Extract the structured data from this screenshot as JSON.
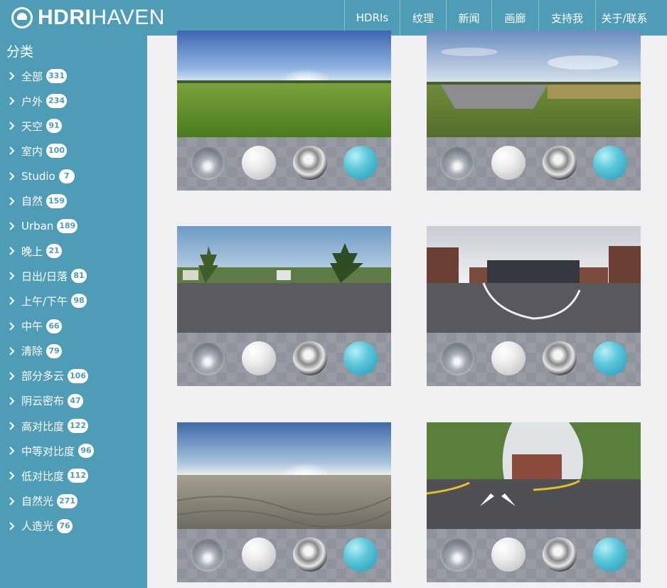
{
  "header": {
    "logo_bold": "HDRI",
    "logo_thin": "HAVEN",
    "nav": [
      {
        "label": "HDRIs",
        "width": 78
      },
      {
        "label": "纹理",
        "width": 65
      },
      {
        "label": "新闻",
        "width": 64
      },
      {
        "label": "画廊",
        "width": 66
      },
      {
        "label": "支持我",
        "width": 80
      },
      {
        "label": "关于/联系",
        "width": 81
      }
    ]
  },
  "sidebar": {
    "title": "分类",
    "items": [
      {
        "label": "全部",
        "count": "331"
      },
      {
        "label": "户外",
        "count": "234"
      },
      {
        "label": "天空",
        "count": "91"
      },
      {
        "label": "室内",
        "count": "100"
      },
      {
        "label": "Studio",
        "count": "7"
      },
      {
        "label": "自然",
        "count": "159"
      },
      {
        "label": "Urban",
        "count": "189"
      },
      {
        "label": "晚上",
        "count": "21"
      },
      {
        "label": "日出/日落",
        "count": "81"
      },
      {
        "label": "上午/下午",
        "count": "98"
      },
      {
        "label": "中午",
        "count": "66"
      },
      {
        "label": "清除",
        "count": "79"
      },
      {
        "label": "部分多云",
        "count": "106"
      },
      {
        "label": "阴云密布",
        "count": "47"
      },
      {
        "label": "高对比度",
        "count": "122"
      },
      {
        "label": "中等对比度",
        "count": "96"
      },
      {
        "label": "低对比度",
        "count": "112"
      },
      {
        "label": "自然光",
        "count": "271"
      },
      {
        "label": "人造光",
        "count": "76"
      }
    ]
  },
  "colors": {
    "brand": "#4f9cb6",
    "background": "#f0f0f2",
    "badge_text": "#4f9cb6"
  },
  "grid": {
    "cards": [
      {
        "scene": "grass-field-pano"
      },
      {
        "scene": "country-road-pano"
      },
      {
        "scene": "park-plaza-pano"
      },
      {
        "scene": "urban-street-pano"
      },
      {
        "scene": "sand-beach-pano"
      },
      {
        "scene": "tree-lined-street-pano"
      }
    ]
  }
}
